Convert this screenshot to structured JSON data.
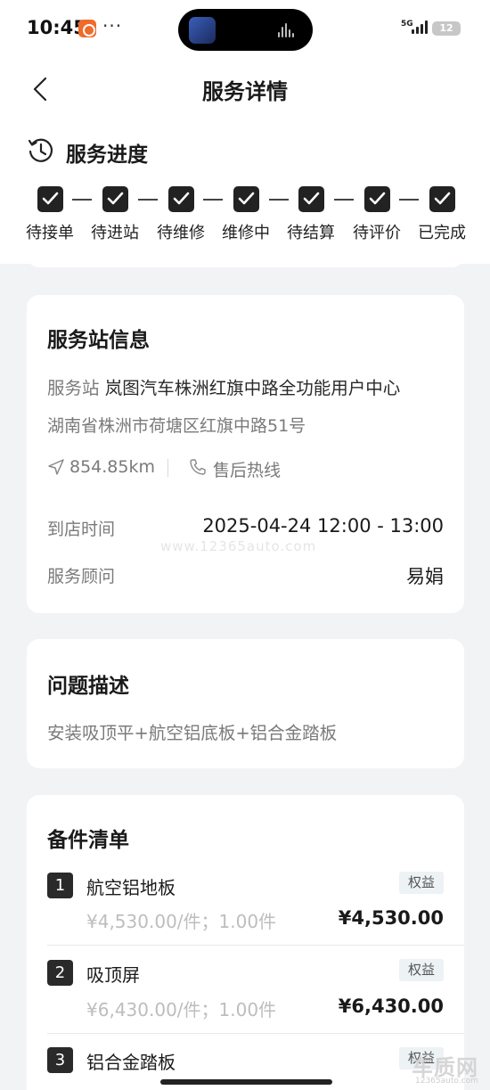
{
  "status_bar": {
    "time": "10:45",
    "dots": "···",
    "network": "5G",
    "battery": "12"
  },
  "header": {
    "title": "服务详情"
  },
  "progress": {
    "title": "服务进度",
    "steps": [
      "待接单",
      "待进站",
      "待维修",
      "维修中",
      "待结算",
      "待评价",
      "已完成"
    ]
  },
  "station": {
    "title": "服务站信息",
    "label": "服务站",
    "name": "岚图汽车株洲红旗中路全功能用户中心",
    "address": "湖南省株洲市荷塘区红旗中路51号",
    "distance": "854.85km",
    "hotline": "售后热线",
    "arrival_label": "到店时间",
    "arrival_value": "2025-04-24 12:00 - 13:00",
    "advisor_label": "服务顾问",
    "advisor_value": "易娟"
  },
  "watermark": "www.12365auto.com",
  "problem": {
    "title": "问题描述",
    "text": "安装吸顶平+航空铝底板+铝合金踏板"
  },
  "parts": {
    "title": "备件清单",
    "items": [
      {
        "index": "1",
        "name": "航空铝地板",
        "tag": "权益",
        "unit": "¥4,530.00/件；1.00件",
        "price": "¥4,530.00"
      },
      {
        "index": "2",
        "name": "吸顶屏",
        "tag": "权益",
        "unit": "¥6,430.00/件；1.00件",
        "price": "¥6,430.00"
      },
      {
        "index": "3",
        "name": "铝合金踏板",
        "tag": "权益"
      }
    ]
  },
  "logo": {
    "cn": "车质网",
    "url": "12365auto.com"
  }
}
